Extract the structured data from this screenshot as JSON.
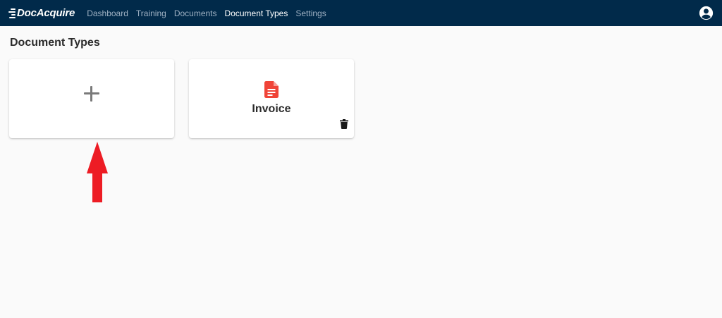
{
  "app": {
    "logo_text": "DocAcquire"
  },
  "nav": {
    "items": [
      {
        "label": "Dashboard",
        "active": false
      },
      {
        "label": "Training",
        "active": false
      },
      {
        "label": "Documents",
        "active": false
      },
      {
        "label": "Document Types",
        "active": true
      },
      {
        "label": "Settings",
        "active": false
      }
    ],
    "account_icon": "account-circle-icon"
  },
  "page": {
    "title": "Document Types"
  },
  "cards": {
    "add": {
      "icon": "plus-icon"
    },
    "document_types": [
      {
        "label": "Invoice",
        "icon": "document-icon",
        "action_icon": "trash-icon"
      }
    ]
  },
  "colors": {
    "navbar": "#012a4a",
    "nav_inactive": "#9fb1c3",
    "nav_active": "#ffffff",
    "page_bg": "#fafafa",
    "doc_icon": "#f04438",
    "annotation_arrow": "#ed1c24"
  }
}
